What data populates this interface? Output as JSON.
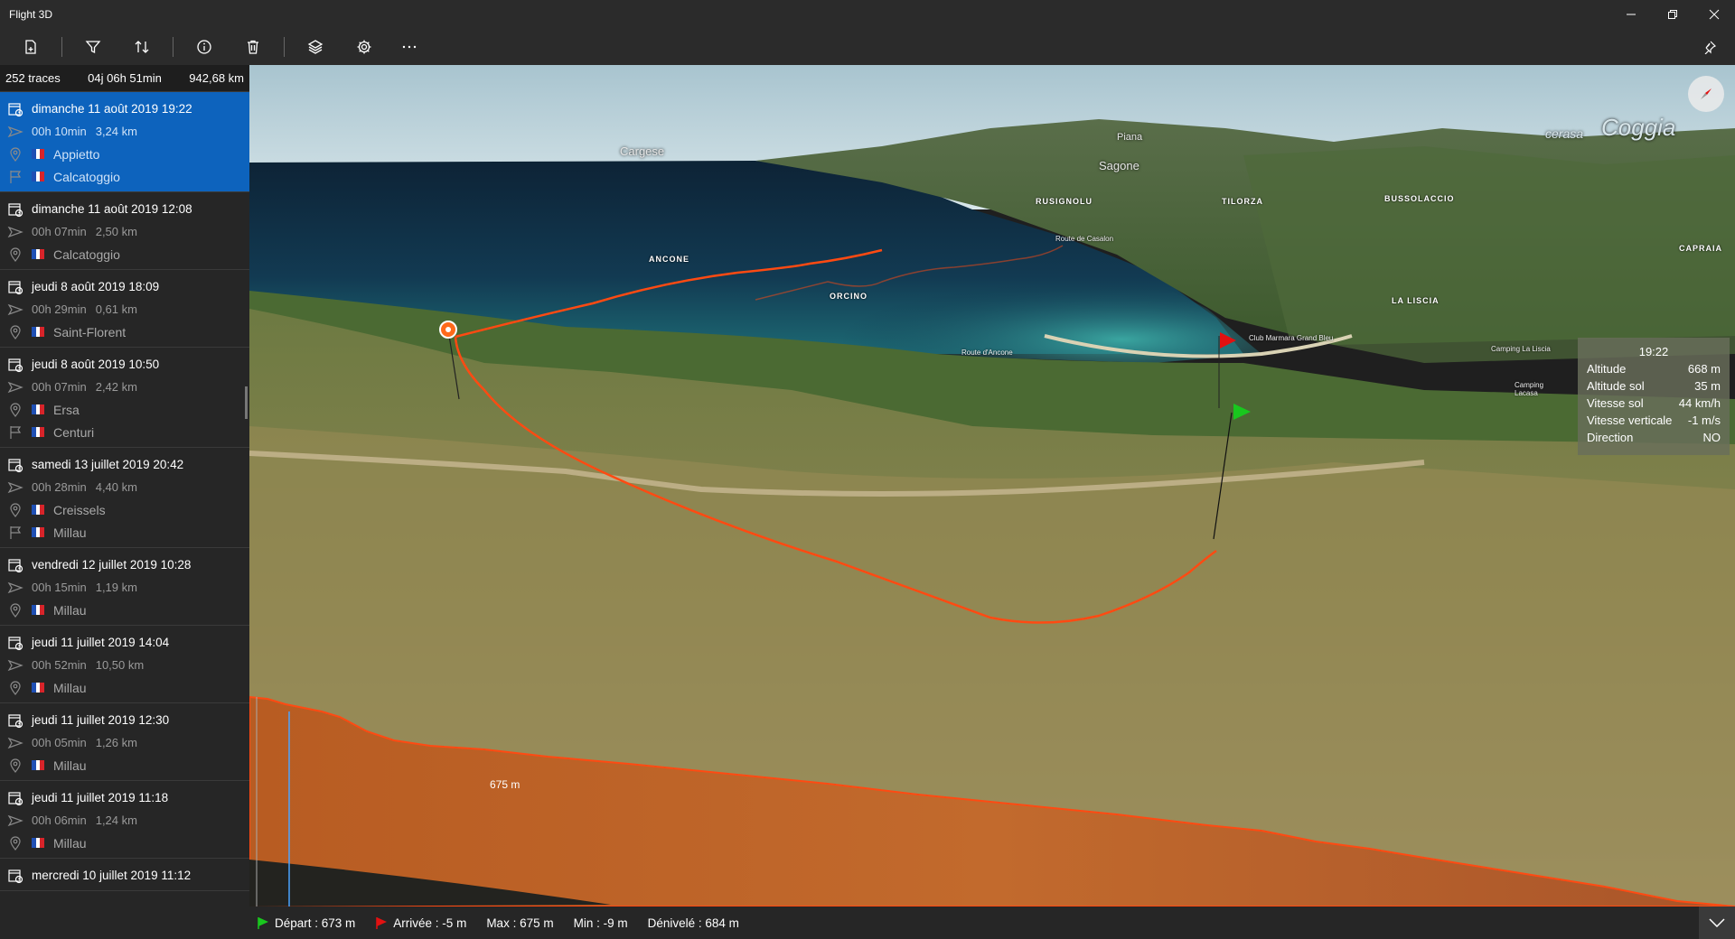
{
  "app": {
    "title": "Flight 3D"
  },
  "toolbar": {
    "buttons": [
      "new-file-icon",
      "filter-icon",
      "sort-icon",
      "info-icon",
      "delete-icon",
      "layers-icon",
      "settings-icon",
      "more-icon"
    ]
  },
  "summary": {
    "traces": "252 traces",
    "duration": "04j 06h 51min",
    "distance": "942,68 km"
  },
  "traces": [
    {
      "date": "dimanche 11 août 2019 19:22",
      "duration": "00h 10min",
      "distance": "3,24 km",
      "start": "Appietto",
      "end": "Calcatoggio",
      "selected": true
    },
    {
      "date": "dimanche 11 août 2019 12:08",
      "duration": "00h 07min",
      "distance": "2,50 km",
      "start": "Calcatoggio",
      "end": null
    },
    {
      "date": "jeudi 8 août 2019 18:09",
      "duration": "00h 29min",
      "distance": "0,61 km",
      "start": "Saint-Florent",
      "end": null
    },
    {
      "date": "jeudi 8 août 2019 10:50",
      "duration": "00h 07min",
      "distance": "2,42 km",
      "start": "Ersa",
      "end": "Centuri"
    },
    {
      "date": "samedi 13 juillet 2019 20:42",
      "duration": "00h 28min",
      "distance": "4,40 km",
      "start": "Creissels",
      "end": "Millau"
    },
    {
      "date": "vendredi 12 juillet 2019 10:28",
      "duration": "00h 15min",
      "distance": "1,19 km",
      "start": "Millau",
      "end": null
    },
    {
      "date": "jeudi 11 juillet 2019 14:04",
      "duration": "00h 52min",
      "distance": "10,50 km",
      "start": "Millau",
      "end": null
    },
    {
      "date": "jeudi 11 juillet 2019 12:30",
      "duration": "00h 05min",
      "distance": "1,26 km",
      "start": "Millau",
      "end": null
    },
    {
      "date": "jeudi 11 juillet 2019 11:18",
      "duration": "00h 06min",
      "distance": "1,24 km",
      "start": "Millau",
      "end": null
    },
    {
      "date": "mercredi 10 juillet 2019 11:12",
      "duration": "",
      "distance": "",
      "start": "",
      "end": null
    }
  ],
  "map": {
    "labels_major": [
      "ANCONE",
      "ORCINO",
      "RUSIGNOLU",
      "TILORZA",
      "BUSSOLACCIO",
      "CAPRAIA",
      "LA LISCIA"
    ],
    "labels_town": [
      "Cargese",
      "Piana",
      "Sagone",
      "Coggia",
      "cerasa"
    ],
    "labels_small": [
      "Route de Casalon",
      "Route d'Ancone",
      "Club Marmara Grand Bleu",
      "Camping La Liscia",
      "Camping Lacasa"
    ]
  },
  "info": {
    "time": "19:22",
    "rows": [
      {
        "label": "Altitude",
        "value": "668 m"
      },
      {
        "label": "Altitude sol",
        "value": "35 m"
      },
      {
        "label": "Vitesse sol",
        "value": "44 km/h"
      },
      {
        "label": "Vitesse verticale",
        "value": "-1 m/s"
      },
      {
        "label": "Direction",
        "value": "NO"
      }
    ]
  },
  "profile": {
    "max_label": "675 m"
  },
  "bottom": {
    "depart": "Départ : 673 m",
    "arrivee": "Arrivée : -5 m",
    "max": "Max : 675 m",
    "min": "Min : -9 m",
    "denivele": "Dénivelé : 684 m"
  },
  "colors": {
    "accent": "#0d63bd",
    "track": "#ff4a12",
    "profile": "#c8622a"
  }
}
